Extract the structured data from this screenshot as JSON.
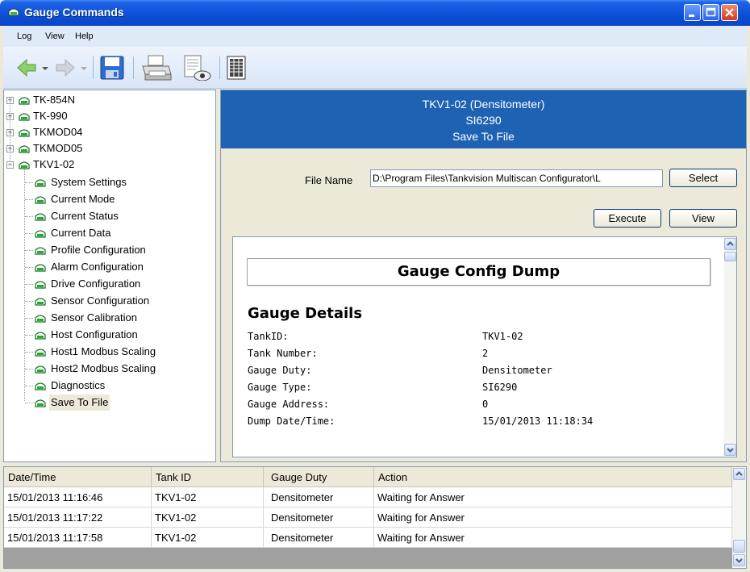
{
  "window": {
    "title": "Gauge Commands"
  },
  "menu": [
    "Log",
    "View",
    "Help"
  ],
  "toolbar": {
    "icons": [
      "back-arrow-icon",
      "forward-arrow-icon",
      "save-icon",
      "print-icon",
      "print-preview-icon",
      "keypad-icon"
    ]
  },
  "tree": {
    "top_nodes": [
      {
        "label": "TK-854N",
        "expander": "+"
      },
      {
        "label": "TK-990",
        "expander": "+"
      },
      {
        "label": "TKMOD04",
        "expander": "+"
      },
      {
        "label": "TKMOD05",
        "expander": "+"
      },
      {
        "label": "TKV1-02",
        "expander": "−"
      }
    ],
    "children": [
      "System Settings",
      "Current Mode",
      "Current Status",
      "Current Data",
      "Profile Configuration",
      "Alarm Configuration",
      "Drive Configuration",
      "Sensor Configuration",
      "Sensor Calibration",
      "Host Configuration",
      "Host1 Modbus Scaling",
      "Host2 Modbus Scaling",
      "Diagnostics",
      "Save To File"
    ],
    "selected": "Save To File"
  },
  "panel": {
    "header": {
      "line1": "TKV1-02 (Densitometer)",
      "line2": "SI6290",
      "line3": "Save To File"
    },
    "file_name_label": "File Name",
    "file_name_value": "D:\\Program Files\\Tankvision Multiscan Configurator\\L",
    "select_label": "Select",
    "execute_label": "Execute",
    "view_label": "View"
  },
  "report": {
    "title": "Gauge Config Dump",
    "details_heading": "Gauge Details",
    "details": [
      {
        "label": "TankID:",
        "value": "TKV1-02"
      },
      {
        "label": "Tank Number:",
        "value": "2"
      },
      {
        "label": "Gauge Duty:",
        "value": "Densitometer"
      },
      {
        "label": "Gauge Type:",
        "value": "SI6290"
      },
      {
        "label": "Gauge Address:",
        "value": "0"
      },
      {
        "label": "Dump Date/Time:",
        "value": "15/01/2013 11:18:34"
      }
    ]
  },
  "log": {
    "columns": [
      "Date/Time",
      "Tank ID",
      "Gauge Duty",
      "Action"
    ],
    "rows": [
      [
        "15/01/2013 11:16:46",
        "TKV1-02",
        "Densitometer",
        "Waiting for Answer"
      ],
      [
        "15/01/2013 11:17:22",
        "TKV1-02",
        "Densitometer",
        "Waiting for Answer"
      ],
      [
        "15/01/2013 11:17:58",
        "TKV1-02",
        "Densitometer",
        "Waiting for Answer"
      ]
    ]
  },
  "colors": {
    "titlebar": "#0a4fd6",
    "panel_header": "#1e62b3",
    "gauge_icon": "#1d9a2a"
  }
}
